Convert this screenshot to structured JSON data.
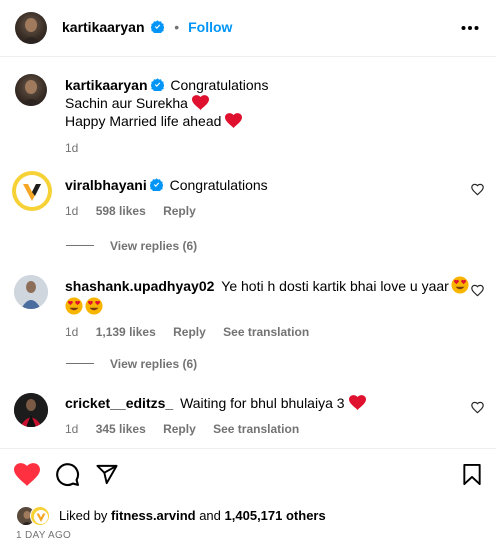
{
  "header": {
    "username": "kartikaaryan",
    "separator": "•",
    "follow_label": "Follow",
    "more_icon": "more-horizontal-icon"
  },
  "caption": {
    "username": "kartikaaryan",
    "text_line1": "Congratulations",
    "text_line2": "Sachin aur Surekha",
    "text_line3": "Happy Married life ahead",
    "time": "1d"
  },
  "comments": [
    {
      "username": "viralbhayani",
      "text": "Congratulations",
      "time": "1d",
      "likes": "598 likes",
      "reply": "Reply",
      "view_replies": "View replies (6)"
    },
    {
      "username": "shashank.upadhyay02",
      "text": "Ye hoti h dosti kartik bhai love u yaar",
      "time": "1d",
      "likes": "1,139 likes",
      "reply": "Reply",
      "translate": "See translation",
      "view_replies": "View replies (6)"
    },
    {
      "username": "cricket__editzs_",
      "text": "Waiting for bhul bhulaiya 3",
      "time": "1d",
      "likes": "345 likes",
      "reply": "Reply",
      "translate": "See translation"
    }
  ],
  "actions": {
    "like_icon": "heart-filled-icon",
    "comment_icon": "comment-icon",
    "share_icon": "send-icon",
    "save_icon": "bookmark-icon"
  },
  "likes_summary": {
    "prefix": "Liked by",
    "user": "fitness.arvind",
    "middle": "and",
    "count": "1,405,171 others"
  },
  "timestamp": "1 DAY AGO",
  "colors": {
    "accent": "#0095f6",
    "like_red": "#ff3040",
    "verified": "#0095f6",
    "muted": "#737373"
  }
}
